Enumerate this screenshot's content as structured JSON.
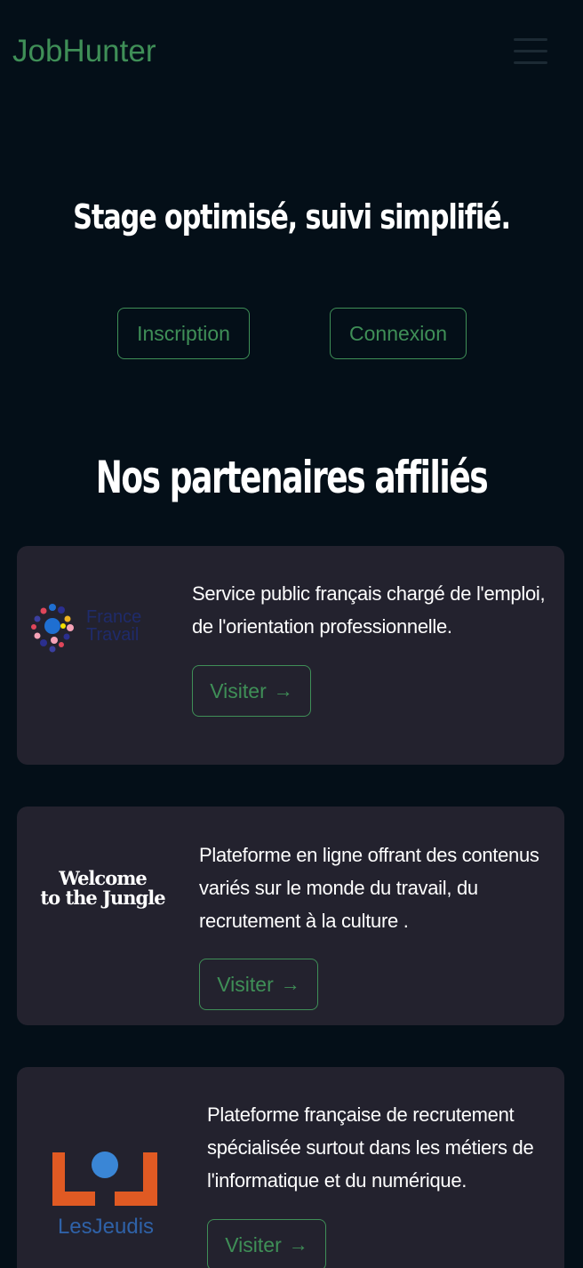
{
  "navbar": {
    "brand": "JobHunter"
  },
  "hero": {
    "title": "Stage optimisé, suivi simplifié.",
    "inscription_label": "Inscription",
    "connexion_label": "Connexion"
  },
  "partners": {
    "title": "Nos partenaires affiliés",
    "items": [
      {
        "logo_line1": "France",
        "logo_line2": "Travail",
        "description": "Service public français chargé de l'emploi, de l'orientation professionnelle.",
        "visit_label": "Visiter",
        "arrow": "→"
      },
      {
        "logo_line1": "Welcome",
        "logo_line2": "to the Jungle",
        "description": "Plateforme en ligne offrant des contenus variés sur le monde du travail, du recrutement à la culture .",
        "visit_label": "Visiter",
        "arrow": "→"
      },
      {
        "logo_text": "LesJeudis",
        "description": "Plateforme française de recrutement spécialisée surtout dans les métiers de l'informatique et du numérique.",
        "visit_label": "Visiter",
        "arrow": "→"
      }
    ]
  },
  "colors": {
    "background": "#040f18",
    "accent": "#3f8f57",
    "card": "#23222e"
  },
  "icons": {
    "menu": "hamburger-icon",
    "arrow": "arrow-right-icon"
  }
}
